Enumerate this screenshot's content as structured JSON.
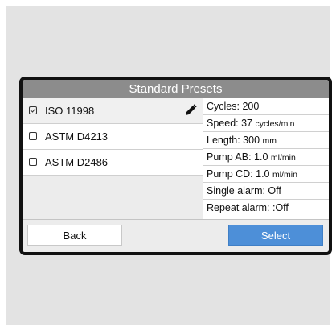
{
  "screen": {
    "title": "Standard Presets"
  },
  "presets": [
    {
      "name": "ISO 11998",
      "checked": true
    },
    {
      "name": "ASTM D4213",
      "checked": false
    },
    {
      "name": "ASTM D2486",
      "checked": false
    }
  ],
  "params": {
    "cycles": "Cycles: 200",
    "speed": "Speed: 37",
    "speed_unit": "cycles/min",
    "length": "Length: 300",
    "length_unit": "mm",
    "pump_ab": "Pump AB: 1.0",
    "pump_ab_unit": "ml/min",
    "pump_cd": "Pump CD: 1.0",
    "pump_cd_unit": "ml/min",
    "single_alarm": "Single alarm: Off",
    "repeat_alarm": "Repeat alarm: :Off"
  },
  "footer": {
    "back_label": "Back",
    "select_label": "Select"
  },
  "colors": {
    "title_bar": "#8c8c8c",
    "select_button": "#4d8fd8"
  },
  "icons": {
    "edit": "pencil-icon",
    "checked": "checkbox-checked-icon",
    "unchecked": "checkbox-unchecked-icon"
  }
}
